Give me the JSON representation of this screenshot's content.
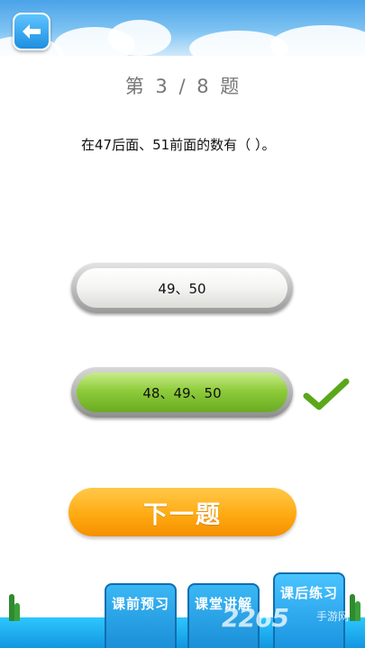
{
  "header": {
    "back_icon": "back-arrow-icon"
  },
  "progress": {
    "prefix": "第",
    "current": "3",
    "separator": "/",
    "total": "8",
    "suffix": "题"
  },
  "question": {
    "text": "在47后面、51前面的数有（ ）。"
  },
  "options": [
    {
      "label": "49、50",
      "state": "unselected"
    },
    {
      "label": "48、49、50",
      "state": "correct"
    }
  ],
  "result": {
    "icon": "checkmark-icon",
    "color": "#5aa81a"
  },
  "next_button": {
    "label": "下一题",
    "color": "#ffab12"
  },
  "bottom_tabs": [
    {
      "label": "课前预习"
    },
    {
      "label": "课堂讲解"
    },
    {
      "label": "课后练习"
    }
  ],
  "watermark": {
    "text": "2265",
    "sub": "手游网"
  }
}
